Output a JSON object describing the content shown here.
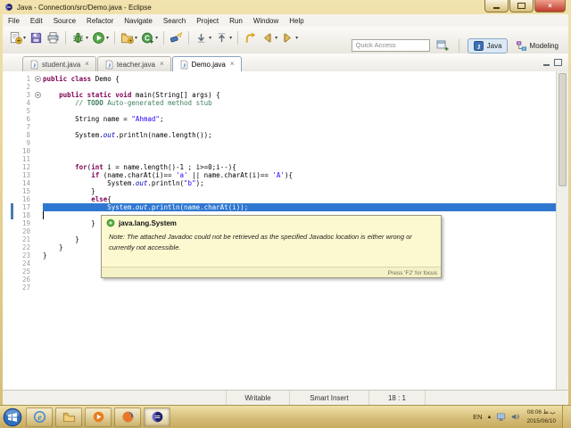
{
  "window": {
    "title": "Java - Connection/src/Demo.java - Eclipse"
  },
  "menu": {
    "items": [
      "File",
      "Edit",
      "Source",
      "Refactor",
      "Navigate",
      "Search",
      "Project",
      "Run",
      "Window",
      "Help"
    ]
  },
  "toolbar": {
    "quick_access": "Quick Access",
    "items": [
      {
        "name": "new-wizard",
        "dropdown": true
      },
      {
        "name": "save"
      },
      {
        "name": "print"
      },
      {
        "sep": true
      },
      {
        "name": "debug",
        "dropdown": true
      },
      {
        "name": "run",
        "dropdown": true
      },
      {
        "sep": true
      },
      {
        "name": "new-java-project",
        "dropdown": true
      },
      {
        "name": "new-class",
        "dropdown": true
      },
      {
        "sep": true
      },
      {
        "name": "search"
      },
      {
        "sep": true
      },
      {
        "name": "next-annotation",
        "dropdown": true
      },
      {
        "name": "prev-annotation",
        "dropdown": true
      },
      {
        "sep": true
      },
      {
        "name": "last-edit"
      },
      {
        "name": "back",
        "dropdown": true
      },
      {
        "name": "forward",
        "dropdown": true
      }
    ],
    "perspectives": [
      {
        "label": "Java",
        "icon": "java-perspective",
        "active": true
      },
      {
        "label": "Modeling",
        "icon": "modeling-perspective",
        "active": false
      }
    ]
  },
  "tabs": [
    {
      "label": "student.java",
      "active": false
    },
    {
      "label": "teacher.java",
      "active": false
    },
    {
      "label": "Demo.java",
      "active": true
    }
  ],
  "editor": {
    "selected_line": 17,
    "cursor_line": 18,
    "lines": [
      {
        "n": 1,
        "fold": true,
        "seg": [
          [
            "public",
            "k"
          ],
          [
            " ",
            "d"
          ],
          [
            "class",
            "k"
          ],
          [
            " Demo {",
            "d"
          ]
        ]
      },
      {
        "n": 2,
        "seg": []
      },
      {
        "n": 3,
        "fold": true,
        "seg": [
          [
            "    ",
            "d"
          ],
          [
            "public",
            "k"
          ],
          [
            " ",
            "d"
          ],
          [
            "static",
            "k"
          ],
          [
            " ",
            "d"
          ],
          [
            "void",
            "k"
          ],
          [
            " main(String[] args) {",
            "d"
          ]
        ]
      },
      {
        "n": 4,
        "seg": [
          [
            "        ",
            "d"
          ],
          [
            "// ",
            "c"
          ],
          [
            "TODO",
            "ct"
          ],
          [
            " Auto-generated method stub",
            "c"
          ]
        ]
      },
      {
        "n": 5,
        "seg": []
      },
      {
        "n": 6,
        "seg": [
          [
            "        String name = ",
            "d"
          ],
          [
            "\"Ahmad\"",
            "s"
          ],
          [
            ";",
            "d"
          ]
        ]
      },
      {
        "n": 7,
        "seg": []
      },
      {
        "n": 8,
        "seg": [
          [
            "        System.",
            "d"
          ],
          [
            "out",
            "f"
          ],
          [
            ".println(name.length());",
            "d"
          ]
        ]
      },
      {
        "n": 9,
        "seg": []
      },
      {
        "n": 10,
        "seg": []
      },
      {
        "n": 11,
        "seg": []
      },
      {
        "n": 12,
        "seg": [
          [
            "        ",
            "d"
          ],
          [
            "for",
            "k"
          ],
          [
            "(",
            "d"
          ],
          [
            "int",
            "k"
          ],
          [
            " i = name.length()-1 ; i>=0;i--){",
            "d"
          ]
        ]
      },
      {
        "n": 13,
        "seg": [
          [
            "            ",
            "d"
          ],
          [
            "if",
            "k"
          ],
          [
            " (name.charAt(i)== ",
            "d"
          ],
          [
            "'a'",
            "s"
          ],
          [
            " || name.charAt(i)== ",
            "d"
          ],
          [
            "'A'",
            "s"
          ],
          [
            "){",
            "d"
          ]
        ]
      },
      {
        "n": 14,
        "seg": [
          [
            "                System.",
            "d"
          ],
          [
            "out",
            "f"
          ],
          [
            ".println(",
            "d"
          ],
          [
            "\"b\"",
            "s"
          ],
          [
            ");",
            "d"
          ]
        ]
      },
      {
        "n": 15,
        "seg": [
          [
            "            }",
            "d"
          ]
        ]
      },
      {
        "n": 16,
        "seg": [
          [
            "            ",
            "d"
          ],
          [
            "else",
            "k"
          ],
          [
            "{",
            "d"
          ]
        ]
      },
      {
        "n": 17,
        "selected": true,
        "seg": [
          [
            "                System.",
            "d"
          ],
          [
            "out",
            "f"
          ],
          [
            ".println(name.charAt(i));",
            "d"
          ]
        ]
      },
      {
        "n": 18,
        "caret": true,
        "seg": []
      },
      {
        "n": 19,
        "seg": [
          [
            "            }",
            "d"
          ]
        ]
      },
      {
        "n": 20,
        "seg": []
      },
      {
        "n": 21,
        "seg": [
          [
            "        }",
            "d"
          ]
        ]
      },
      {
        "n": 22,
        "seg": [
          [
            "    }",
            "d"
          ]
        ]
      },
      {
        "n": 23,
        "seg": [
          [
            "}",
            "d"
          ]
        ]
      },
      {
        "n": 24,
        "seg": []
      },
      {
        "n": 25,
        "seg": []
      },
      {
        "n": 26,
        "seg": []
      },
      {
        "n": 27,
        "seg": []
      }
    ]
  },
  "tooltip": {
    "title": "java.lang.System",
    "body": "Note: The attached Javadoc could not be retrieved as the specified Javadoc location is either wrong or currently not accessible.",
    "hint": "Press 'F2' for focus"
  },
  "status": {
    "writable": "Writable",
    "mode": "Smart Insert",
    "position": "18 : 1"
  },
  "taskbar": {
    "apps": [
      {
        "name": "internet-explorer",
        "active": false
      },
      {
        "name": "explorer",
        "active": false
      },
      {
        "name": "media-player",
        "active": false
      },
      {
        "name": "firefox",
        "active": false
      },
      {
        "name": "eclipse-app",
        "active": true
      }
    ],
    "tray": {
      "lang": "EN",
      "time": "08:06 ب.ظ",
      "date": "2015/06/10"
    }
  }
}
